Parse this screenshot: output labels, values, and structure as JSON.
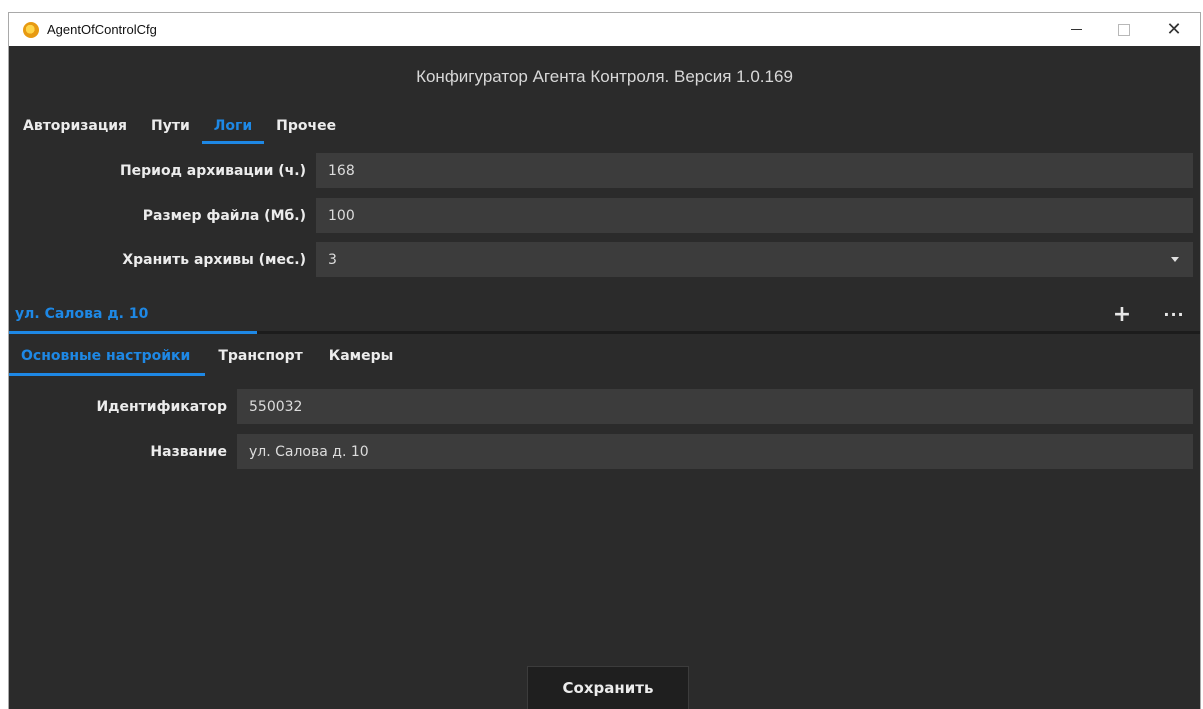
{
  "window": {
    "title": "AgentOfControlCfg",
    "controls": {
      "minimize": "—",
      "maximize": "☐",
      "close": "✕"
    }
  },
  "header": {
    "title": "Конфигуратор Агента Контроля. Версия 1.0.169"
  },
  "main_tabs": [
    {
      "label": "Авторизация",
      "active": false
    },
    {
      "label": "Пути",
      "active": false
    },
    {
      "label": "Логи",
      "active": true
    },
    {
      "label": "Прочее",
      "active": false
    }
  ],
  "logs": {
    "archive_period_label": "Период архивации (ч.)",
    "archive_period_value": "168",
    "file_size_label": "Размер файла (Мб.)",
    "file_size_value": "100",
    "keep_archives_label": "Хранить архивы (мес.)",
    "keep_archives_value": "3"
  },
  "object": {
    "tab_label": "ул. Салова д. 10",
    "add_label": "+",
    "more_label": "···"
  },
  "sub_tabs": [
    {
      "label": "Основные настройки",
      "active": true
    },
    {
      "label": "Транспорт",
      "active": false
    },
    {
      "label": "Камеры",
      "active": false
    }
  ],
  "settings": {
    "id_label": "Идентификатор",
    "id_value": "550032",
    "name_label": "Название",
    "name_value": "ул. Салова д. 10"
  },
  "footer": {
    "save_label": "Сохранить"
  },
  "colors": {
    "accent": "#1e88e5",
    "background": "#2b2b2b",
    "field": "#3c3c3c"
  }
}
